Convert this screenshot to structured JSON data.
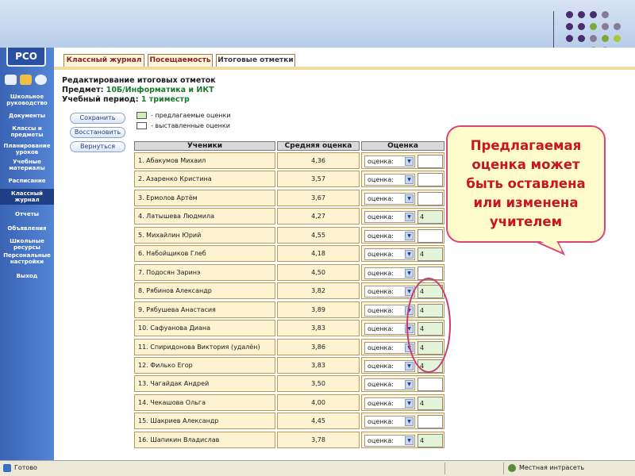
{
  "deco": {
    "band": "#c6d8ee",
    "dots": [
      "#4a2a70",
      "#8a7a9a",
      "#7aaa3a",
      "#a8c83a"
    ]
  },
  "app": {
    "logo": "РСО"
  },
  "tabs": [
    {
      "label": "Классный журнал",
      "active": false
    },
    {
      "label": "Посещаемость",
      "active": false
    },
    {
      "label": "Итоговые отметки",
      "active": true
    }
  ],
  "sidebar": {
    "items": [
      {
        "label": "Школьное руководство"
      },
      {
        "label": "Документы"
      },
      {
        "label": "Классы и предметы"
      },
      {
        "label": "Планирование уроков"
      },
      {
        "label": "Учебные материалы"
      },
      {
        "label": "Расписание"
      },
      {
        "label": "Классный журнал",
        "active": true
      },
      {
        "label": "Отчеты"
      },
      {
        "label": "Объявления"
      },
      {
        "label": "Школьные ресурсы"
      },
      {
        "label": "Персональные настройки"
      },
      {
        "label": "Выход"
      }
    ]
  },
  "page": {
    "heading": "Редактирование итоговых отметок",
    "subject_label": "Предмет:",
    "subject_value": "10Б/Информатика и ИКТ",
    "period_label": "Учебный период:",
    "period_value": "1 триместр"
  },
  "actions": {
    "save": "Сохранить",
    "restore": "Восстановить",
    "back": "Вернуться"
  },
  "legend": {
    "suggested": "- предлагаемые оценки",
    "assigned": "- выставленные оценки",
    "suggested_color": "#cfeec0",
    "assigned_color": "#ffffff"
  },
  "table": {
    "headers": {
      "students": "Ученики",
      "average": "Средняя оценка",
      "grade": "Оценка"
    },
    "select_label": "оценка:",
    "rows": [
      {
        "name": "1. Абакумов Михаил",
        "avg": "4,36",
        "grade": ""
      },
      {
        "name": "2. Азаренко Кристина",
        "avg": "3,57",
        "grade": ""
      },
      {
        "name": "3. Ермолов Артём",
        "avg": "3,67",
        "grade": ""
      },
      {
        "name": "4. Латышева Людмила",
        "avg": "4,27",
        "grade": "4"
      },
      {
        "name": "5. Михайлин Юрий",
        "avg": "4,55",
        "grade": ""
      },
      {
        "name": "6. Набойщиков Глеб",
        "avg": "4,18",
        "grade": "4"
      },
      {
        "name": "7. Подосян Заринэ",
        "avg": "4,50",
        "grade": ""
      },
      {
        "name": "8. Рябинов Александр",
        "avg": "3,82",
        "grade": "4"
      },
      {
        "name": "9. Рябушева Анастасия",
        "avg": "3,89",
        "grade": "4"
      },
      {
        "name": "10. Сафуанова Диана",
        "avg": "3,83",
        "grade": "4"
      },
      {
        "name": "11. Спиридонова Виктория (удалён)",
        "avg": "3,86",
        "grade": "4"
      },
      {
        "name": "12. Филько Егор",
        "avg": "3,83",
        "grade": "4"
      },
      {
        "name": "13. Чагайдак Андрей",
        "avg": "3,50",
        "grade": ""
      },
      {
        "name": "14. Чекашова Ольга",
        "avg": "4,00",
        "grade": "4"
      },
      {
        "name": "15. Шакриев Александр",
        "avg": "4,45",
        "grade": ""
      },
      {
        "name": "16. Шапикин Владислав",
        "avg": "3,78",
        "grade": "4"
      }
    ]
  },
  "callout": {
    "lines": [
      "Предлагаемая",
      "оценка может",
      "быть оставлена",
      "или изменена",
      "учителем"
    ]
  },
  "status": {
    "left": "Готово",
    "zone": "Местная интрасеть"
  },
  "colors": {
    "sidebar": "#4a76c8",
    "row_bg": "#fdf3d0",
    "callout_border": "#d9437e",
    "callout_text": "#c8161e",
    "tab_bar": "#f1dc9e"
  }
}
